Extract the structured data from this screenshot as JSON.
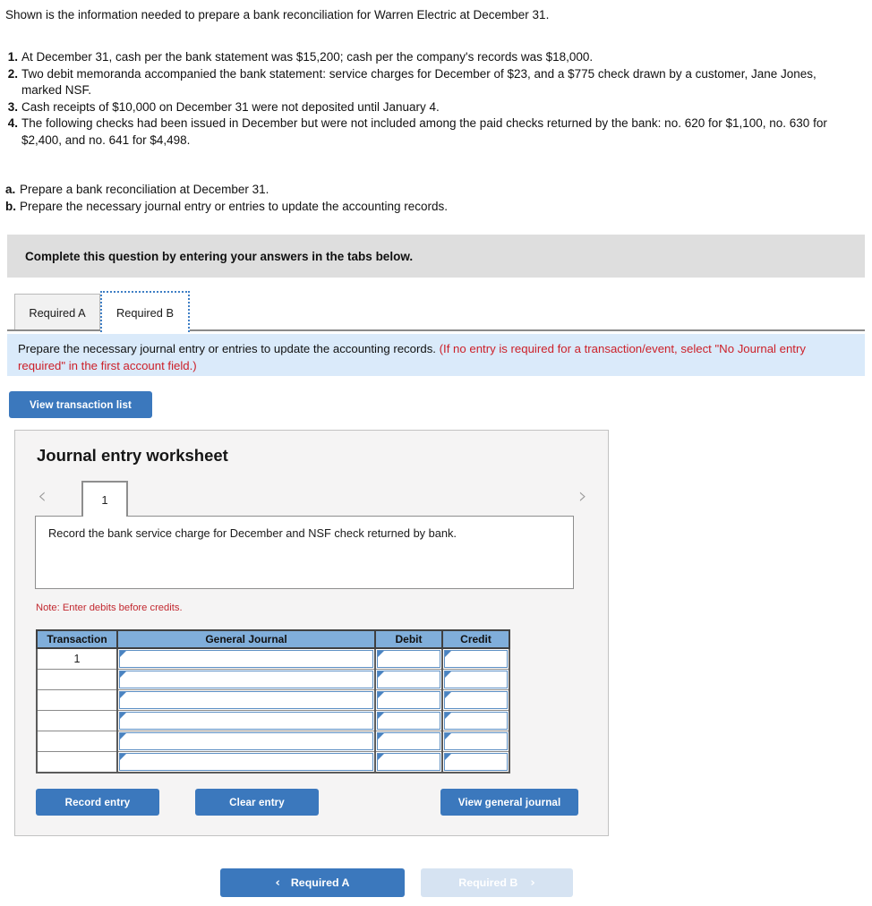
{
  "intro": "Shown is the information needed to prepare a bank reconciliation for Warren Electric at December 31.",
  "facts": [
    {
      "num": "1.",
      "text": "At December 31, cash per the bank statement was $15,200; cash per the company's records was $18,000."
    },
    {
      "num": "2.",
      "text": "Two debit memoranda accompanied the bank statement: service charges for December of $23, and a $775 check drawn by a customer, Jane Jones, marked NSF."
    },
    {
      "num": "3.",
      "text": "Cash receipts of $10,000 on December 31 were not deposited until January 4."
    },
    {
      "num": "4.",
      "text": "The following checks had been issued in December but were not included among the paid checks returned by the bank: no. 620 for $1,100, no. 630 for $2,400, and no. 641 for $4,498."
    }
  ],
  "requirements": [
    {
      "letter": "a.",
      "text": "Prepare a bank reconciliation at December 31."
    },
    {
      "letter": "b.",
      "text": "Prepare the necessary journal entry or entries to update the accounting records."
    }
  ],
  "banner": {
    "text": "Complete this question by entering your answers in the tabs below."
  },
  "tabs": [
    {
      "label": "Required A",
      "active": false
    },
    {
      "label": "Required B",
      "active": true
    }
  ],
  "instruction": {
    "black": "Prepare the necessary journal entry or entries to update the accounting records.",
    "red": "(If no entry is required for a transaction/event, select \"No Journal entry required\" in the first account field.)"
  },
  "view_transaction_list_label": "View transaction list",
  "worksheet": {
    "title": "Journal entry worksheet",
    "prev_icon": "chevron-left-icon",
    "next_icon": "chevron-right-icon",
    "page_number": "1",
    "description": "Record the bank service charge for December and NSF check returned by bank.",
    "note": "Note: Enter debits before credits.",
    "table": {
      "headers": [
        "Transaction",
        "General Journal",
        "Debit",
        "Credit"
      ],
      "rows": [
        {
          "transaction": "1",
          "general_journal": "",
          "debit": "",
          "credit": ""
        },
        {
          "transaction": "",
          "general_journal": "",
          "debit": "",
          "credit": ""
        },
        {
          "transaction": "",
          "general_journal": "",
          "debit": "",
          "credit": ""
        },
        {
          "transaction": "",
          "general_journal": "",
          "debit": "",
          "credit": ""
        },
        {
          "transaction": "",
          "general_journal": "",
          "debit": "",
          "credit": ""
        },
        {
          "transaction": "",
          "general_journal": "",
          "debit": "",
          "credit": ""
        }
      ]
    },
    "record_entry_label": "Record entry",
    "clear_entry_label": "Clear entry",
    "view_general_journal_label": "View general journal"
  },
  "bottom_nav": {
    "prev_arrow": "‹",
    "prev_label": "Required A",
    "next_label": "Required B",
    "next_arrow": "›"
  },
  "colors": {
    "primary_blue": "#3b78bd",
    "table_header_blue": "#80aeda",
    "info_blue": "#daeafa",
    "banner_gray": "#dedede",
    "panel_gray": "#f5f4f4",
    "red": "#cc2029",
    "disabled_blue": "#d6e3f2"
  }
}
